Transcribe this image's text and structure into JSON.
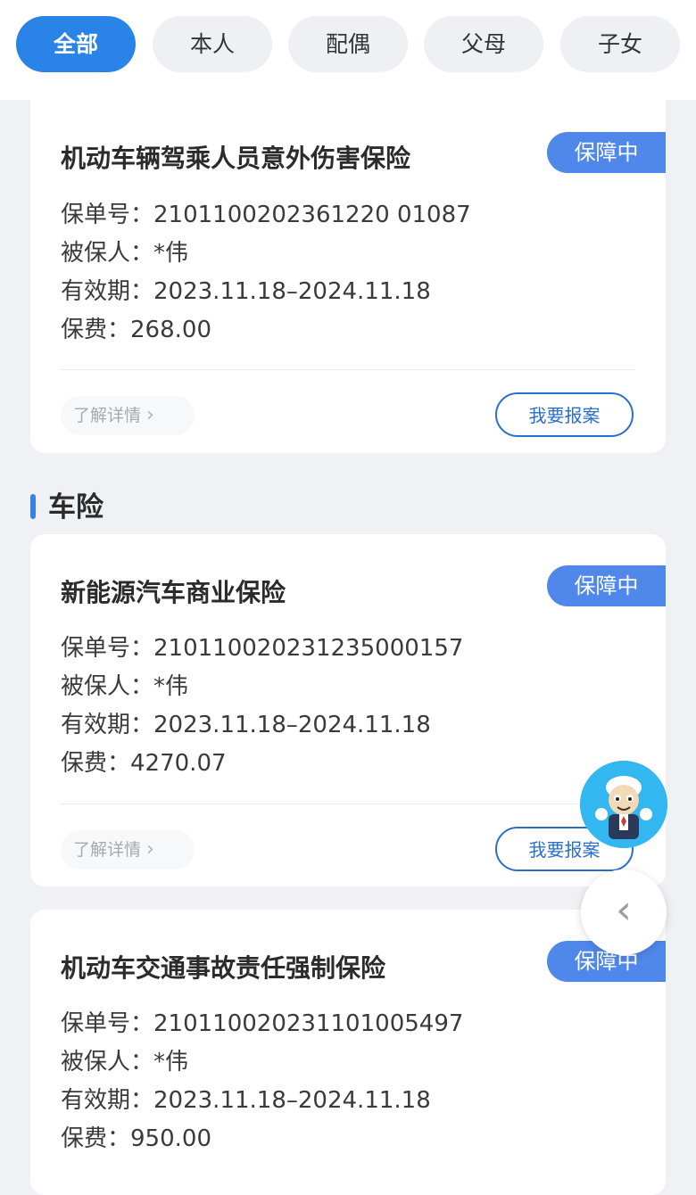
{
  "tabs": [
    {
      "label": "全部"
    },
    {
      "label": "本人"
    },
    {
      "label": "配偶"
    },
    {
      "label": "父母"
    },
    {
      "label": "子女"
    }
  ],
  "labels": {
    "policy_no": "保单号：",
    "insured": "被保人：",
    "validity": "有效期：",
    "premium": "保费："
  },
  "actions": {
    "detail": "了解详情",
    "report": "我要报案"
  },
  "section_car": "车险",
  "policies": [
    {
      "title": "机动车辆驾乘人员意外伤害保险",
      "status": "保障中",
      "policy_no": "2101100202361220 01087",
      "insured": "*伟",
      "validity": "2023.11.18–2024.11.18",
      "premium": "268.00"
    },
    {
      "title": "新能源汽车商业保险",
      "status": "保障中",
      "policy_no": "210110020231235000157",
      "insured": "*伟",
      "validity": "2023.11.18–2024.11.18",
      "premium": "4270.07"
    },
    {
      "title": "机动车交通事故责任强制保险",
      "status": "保障中",
      "policy_no": "210110020231101005497",
      "insured": "*伟",
      "validity": "2023.11.18–2024.11.18",
      "premium": "950.00"
    }
  ],
  "icons": {
    "assistant": "assistant-avatar-icon",
    "back": "chevron-left-icon",
    "detail_arrow": "chevron-right-icon"
  },
  "colors": {
    "primary": "#2a83e6",
    "status": "#4f87eb",
    "report_border": "#2a6fca"
  }
}
